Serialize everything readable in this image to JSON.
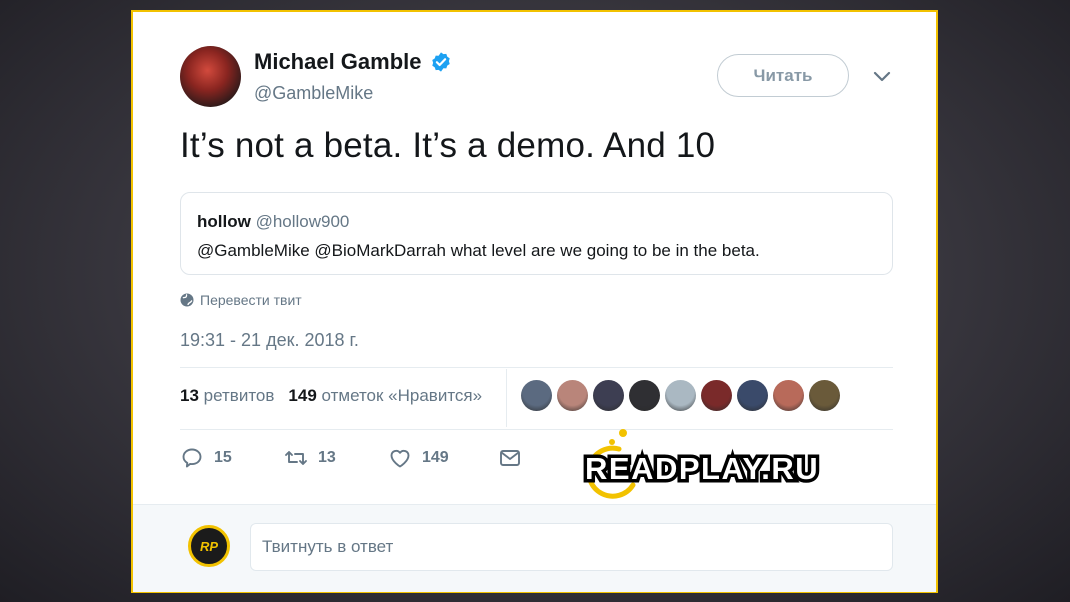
{
  "author": {
    "name": "Michael Gamble",
    "handle": "@GambleMike"
  },
  "follow_button_label": "Читать",
  "tweet_text": "It’s not a beta. It’s a demo. And 10",
  "quoted_tweet": {
    "name": "hollow",
    "handle": "@hollow900",
    "text": "@GambleMike @BioMarkDarrah what level are we going to be in the beta."
  },
  "translate_label": "Перевести твит",
  "timestamp": "19:31 - 21 дек. 2018 г.",
  "stats": {
    "retweets_count": "13",
    "retweets_label": "ретвитов",
    "likes_count": "149",
    "likes_label": "отметок «Нравится»"
  },
  "liker_avatar_colors": [
    "#5b6a80",
    "#b9857a",
    "#3d3e52",
    "#2f2f33",
    "#aab8c2",
    "#7a2a2a",
    "#3a4a6a",
    "#b86a5a",
    "#6a5a3a"
  ],
  "actions": {
    "reply_count": "15",
    "retweet_count": "13",
    "like_count": "149"
  },
  "watermark_text": "READPLAY.RU",
  "reply_avatar_text": "RP",
  "reply_placeholder": "Твитнуть в ответ",
  "colors": {
    "accent_yellow": "#f2c200",
    "verified_blue": "#1da1f2",
    "muted_text": "#657786"
  }
}
